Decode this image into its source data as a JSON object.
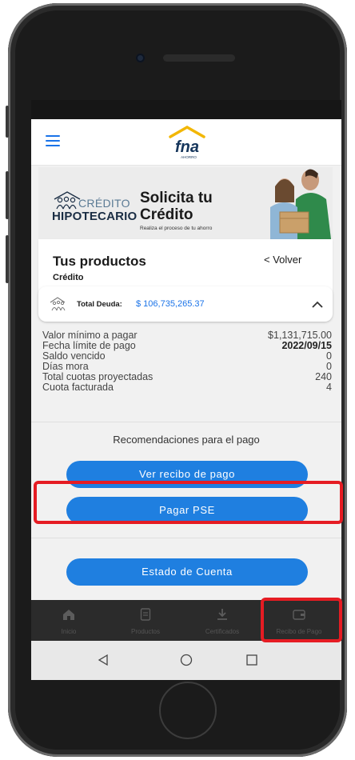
{
  "app": {
    "logo_text": "fna",
    "logo_sub": "AHORRO"
  },
  "banner": {
    "brand_credito": "CRÉDITO",
    "brand_hipotecario": "HIPOTECARIO",
    "title": "Solicita tu Crédito",
    "subtitle": "Realiza el proceso de tu ahorro"
  },
  "products": {
    "title": "Tus productos",
    "subtitle": "Crédito",
    "back_label": "< Volver"
  },
  "debt": {
    "label": "Total Deuda:",
    "value": "$ 106,735,265.37"
  },
  "details": [
    {
      "key": "Valor mínimo a pagar",
      "value": "$1,131,715.00"
    },
    {
      "key": "Fecha límite de pago",
      "value": "2022/09/15"
    },
    {
      "key": "Saldo vencido",
      "value": "0"
    },
    {
      "key": "Días mora",
      "value": "0"
    },
    {
      "key": "Total cuotas proyectadas",
      "value": "240"
    },
    {
      "key": "Cuota facturada",
      "value": "4"
    }
  ],
  "recommendations": {
    "title": "Recomendaciones para el pago",
    "view_receipt_button": "Ver recibo de pago",
    "pay_pse_button": "Pagar PSE",
    "statement_button": "Estado de Cuenta"
  },
  "bottom_nav": [
    {
      "label": "Inicio",
      "icon": "home-icon"
    },
    {
      "label": "Productos",
      "icon": "document-icon"
    },
    {
      "label": "Certificados",
      "icon": "download-icon"
    },
    {
      "label": "Recibo de Pago",
      "icon": "wallet-icon"
    }
  ],
  "colors": {
    "accent": "#1f7fe0",
    "highlight": "#e51c23",
    "nav_background": "#2b2b2b"
  }
}
